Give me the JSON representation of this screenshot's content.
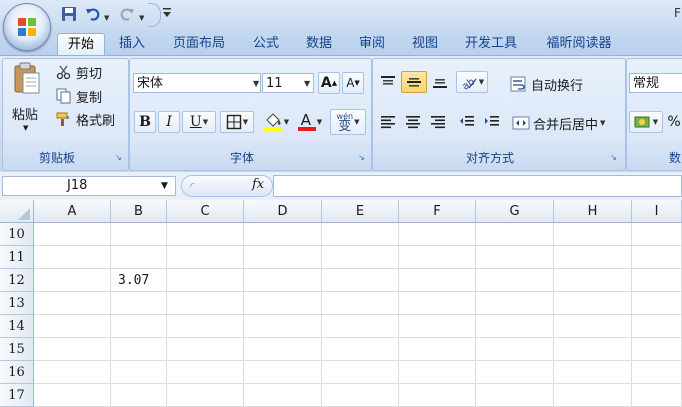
{
  "titlebar": {
    "edge_text": "F"
  },
  "tabs": [
    {
      "label": "开始"
    },
    {
      "label": "插入"
    },
    {
      "label": "页面布局"
    },
    {
      "label": "公式"
    },
    {
      "label": "数据"
    },
    {
      "label": "审阅"
    },
    {
      "label": "视图"
    },
    {
      "label": "开发工具"
    },
    {
      "label": "福昕阅读器"
    }
  ],
  "clipboard": {
    "paste_label": "粘贴",
    "cut_label": "剪切",
    "copy_label": "复制",
    "format_painter_label": "格式刷",
    "group_label": "剪贴板"
  },
  "font": {
    "font_name": "宋体",
    "font_size": "11",
    "grow_label": "A",
    "shrink_label": "A",
    "bold_label": "B",
    "italic_label": "I",
    "underline_label": "U",
    "font_color_label": "A",
    "phonetic_label": "wén",
    "phonetic_char": "变",
    "group_label": "字体"
  },
  "alignment": {
    "wrap_text_label": "自动换行",
    "merge_center_label": "合并后居中",
    "group_label": "对齐方式"
  },
  "number": {
    "format": "常规",
    "percent_label": "%",
    "group_label": "数"
  },
  "formula_bar": {
    "name_box": "J18",
    "fx_label": "fx",
    "formula": ""
  },
  "sheet": {
    "columns": [
      "A",
      "B",
      "C",
      "D",
      "E",
      "F",
      "G",
      "H",
      "I"
    ],
    "rows": [
      {
        "num": "10",
        "cells": [
          "",
          "",
          "",
          "",
          "",
          "",
          "",
          "",
          ""
        ]
      },
      {
        "num": "11",
        "cells": [
          "",
          "",
          "",
          "",
          "",
          "",
          "",
          "",
          ""
        ]
      },
      {
        "num": "12",
        "cells": [
          "",
          "3.07",
          "",
          "",
          "",
          "",
          "",
          "",
          ""
        ]
      },
      {
        "num": "13",
        "cells": [
          "",
          "",
          "",
          "",
          "",
          "",
          "",
          "",
          ""
        ]
      },
      {
        "num": "14",
        "cells": [
          "",
          "",
          "",
          "",
          "",
          "",
          "",
          "",
          ""
        ]
      },
      {
        "num": "15",
        "cells": [
          "",
          "",
          "",
          "",
          "",
          "",
          "",
          "",
          ""
        ]
      },
      {
        "num": "16",
        "cells": [
          "",
          "",
          "",
          "",
          "",
          "",
          "",
          "",
          ""
        ]
      },
      {
        "num": "17",
        "cells": [
          "",
          "",
          "",
          "",
          "",
          "",
          "",
          "",
          ""
        ]
      }
    ]
  },
  "colors": {
    "font_color_bar": "#e81c1c",
    "highlight_bar": "#ffff00",
    "tab_text": "#15428b"
  }
}
